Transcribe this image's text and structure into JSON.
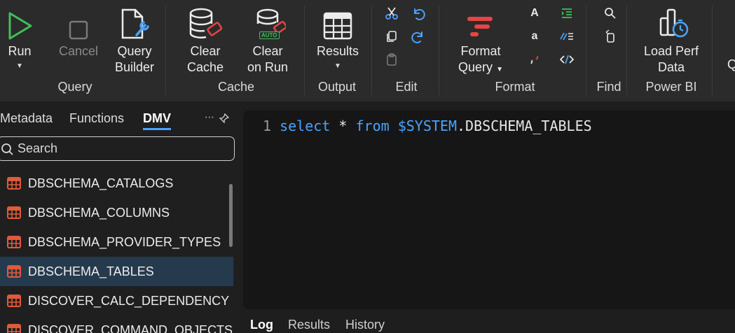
{
  "ribbon": {
    "query_group": {
      "label": "Query",
      "run": "Run",
      "cancel": "Cancel",
      "query_builder_l1": "Query",
      "query_builder_l2": "Builder"
    },
    "cache_group": {
      "label": "Cache",
      "clear_cache_l1": "Clear",
      "clear_cache_l2": "Cache",
      "clear_on_run_l1": "Clear",
      "clear_on_run_l2": "on Run",
      "auto_badge": "AUTO"
    },
    "output_group": {
      "label": "Output",
      "results": "Results"
    },
    "edit_group": {
      "label": "Edit"
    },
    "format_group": {
      "label": "Format",
      "format_query_l1": "Format",
      "format_query_l2": "Query",
      "upper_glyph": "A",
      "lower_glyph": "a"
    },
    "find_group": {
      "label": "Find"
    },
    "powerbi_group": {
      "label": "Power BI",
      "load_perf_l1": "Load Perf",
      "load_perf_l2": "Data"
    },
    "cut_off_label": "Q"
  },
  "left_panel": {
    "tabs": [
      "Metadata",
      "Functions",
      "DMV"
    ],
    "active_tab": "DMV",
    "search_placeholder": "Search",
    "items": [
      "DBSCHEMA_CATALOGS",
      "DBSCHEMA_COLUMNS",
      "DBSCHEMA_PROVIDER_TYPES",
      "DBSCHEMA_TABLES",
      "DISCOVER_CALC_DEPENDENCY",
      "DISCOVER_COMMAND_OBJECTS"
    ],
    "selected_item": "DBSCHEMA_TABLES"
  },
  "editor": {
    "line_number": "1",
    "kw_select": "select",
    "star": "*",
    "kw_from": "from",
    "system": "$SYSTEM",
    "table": ".DBSCHEMA_TABLES"
  },
  "bottom_tabs": [
    "Log",
    "Results",
    "History"
  ],
  "colors": {
    "accent": "#4aa3ff",
    "run_green": "#3fbf5a",
    "red": "#e64545",
    "selection": "#263a4d"
  }
}
